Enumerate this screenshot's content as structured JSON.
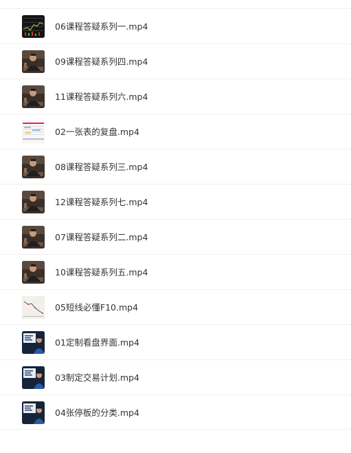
{
  "files": [
    {
      "name": "06课程答疑系列一.mp4",
      "thumbnail": "dark-chart-thumbnail"
    },
    {
      "name": "09课程答疑系列四.mp4",
      "thumbnail": "video-person-thumbnail"
    },
    {
      "name": "11课程答疑系列六.mp4",
      "thumbnail": "video-person-thumbnail"
    },
    {
      "name": "02一张表的复盘.mp4",
      "thumbnail": "spreadsheet-thumbnail"
    },
    {
      "name": "08课程答疑系列三.mp4",
      "thumbnail": "video-person-thumbnail"
    },
    {
      "name": "12课程答疑系列七.mp4",
      "thumbnail": "video-person-thumbnail"
    },
    {
      "name": "07课程答疑系列二.mp4",
      "thumbnail": "video-person-thumbnail"
    },
    {
      "name": "10课程答疑系列五.mp4",
      "thumbnail": "video-person-thumbnail"
    },
    {
      "name": "05短线必懂F10.mp4",
      "thumbnail": "chart-light-thumbnail"
    },
    {
      "name": "01定制看盘界面.mp4",
      "thumbnail": "presenter-screen-thumbnail"
    },
    {
      "name": "03制定交易计划.mp4",
      "thumbnail": "presenter-screen-thumbnail"
    },
    {
      "name": "04张停板的分类.mp4",
      "thumbnail": "presenter-screen-thumbnail"
    }
  ]
}
